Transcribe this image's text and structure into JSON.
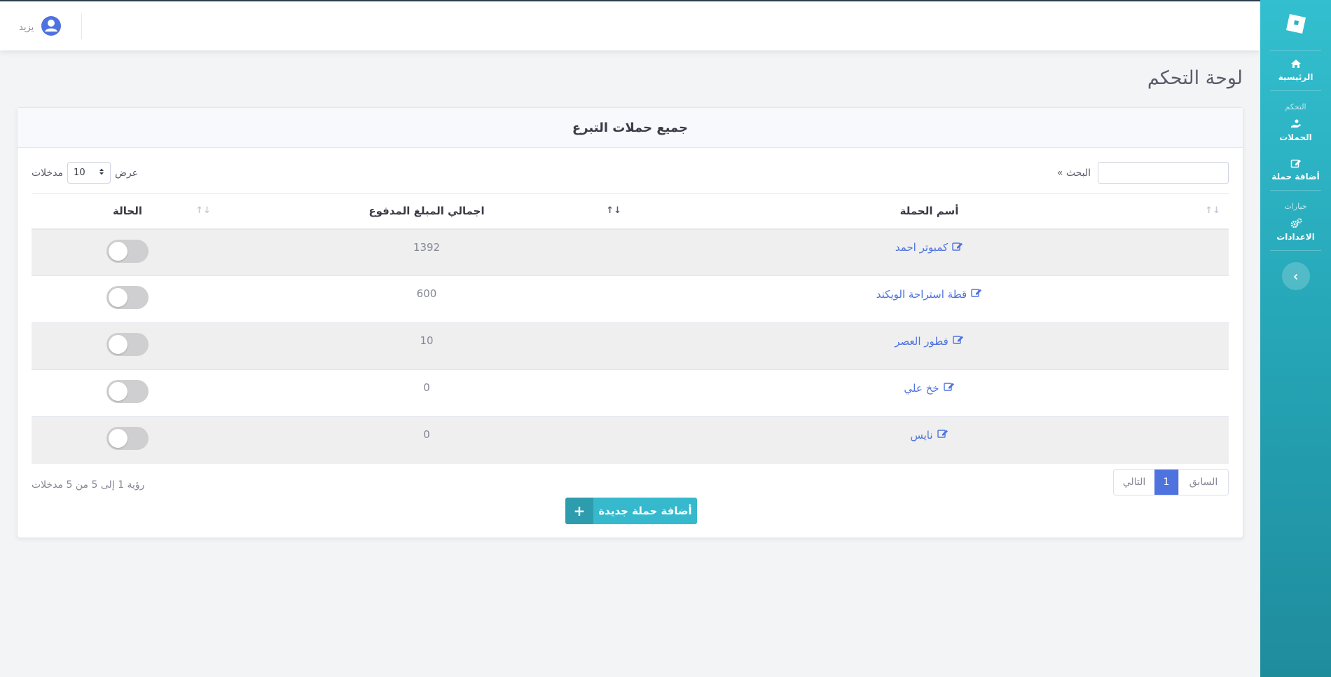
{
  "sidebar": {
    "brand_icon": "roblox-square-logo-icon",
    "home": {
      "label": "الرئيسية",
      "icon": "home-icon"
    },
    "section_control": "التحكم",
    "campaigns": {
      "label": "الحملات",
      "icon": "hand-donate-icon"
    },
    "add_campaign": {
      "label": "أضافة حملة",
      "icon": "edit-icon"
    },
    "section_options": "خيارات",
    "settings": {
      "label": "الاعدادات",
      "icon": "cogs-icon"
    },
    "collapse_icon": "chevron-left-icon"
  },
  "topbar": {
    "user_name": "يزيد",
    "user_icon": "user-circle-icon"
  },
  "page": {
    "title": "لوحة التحكم"
  },
  "card": {
    "title": "جميع حملات التبرع",
    "search_label": "« البحث",
    "length_show": "عرض",
    "length_value": "10",
    "length_entries": "مدخلات",
    "columns": {
      "name": "أسم الحملة",
      "total": "اجمالي المبلغ المدفوع",
      "status": "الحالة"
    },
    "rows": [
      {
        "name": "كمبوتر احمد",
        "total": "1392",
        "active": false
      },
      {
        "name": "قطة استراحة الويكند",
        "total": "600",
        "active": false
      },
      {
        "name": "فطور العصر",
        "total": "10",
        "active": false
      },
      {
        "name": "خخ علي",
        "total": "0",
        "active": false
      },
      {
        "name": "نايس",
        "total": "0",
        "active": false
      }
    ],
    "info": "رؤية 1 إلى 5 من 5 مدخلات",
    "pager": {
      "next": "التالي",
      "current": "1",
      "prev": "السابق"
    },
    "add_button": "أضافة حملة جديدة"
  },
  "colors": {
    "sidebar": "#36b9cc",
    "primary": "#4e73df",
    "info": "#36b9cc"
  }
}
